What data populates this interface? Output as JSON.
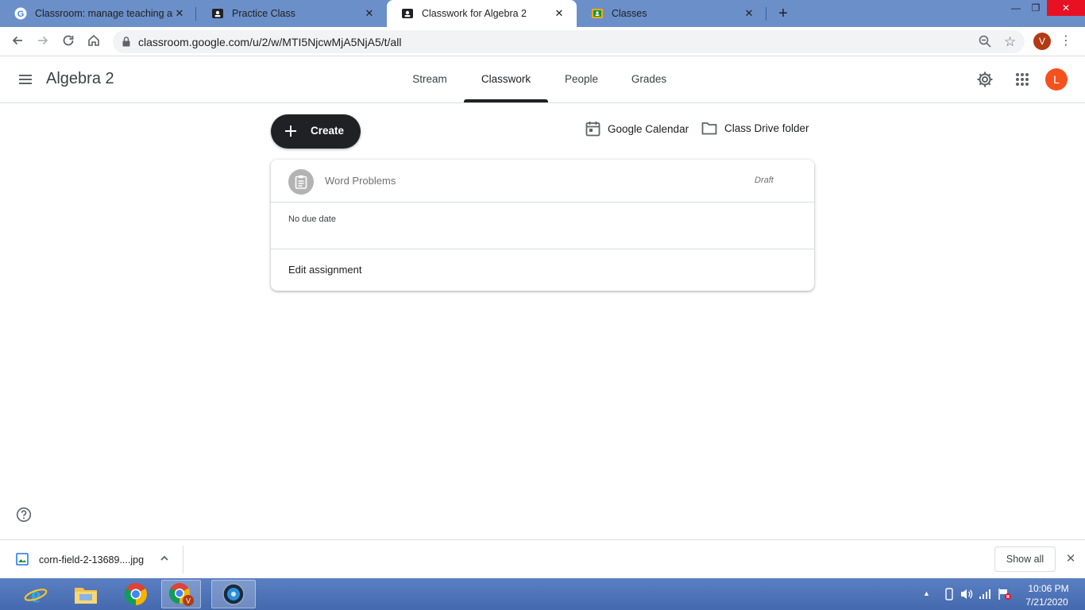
{
  "browser": {
    "tabs": [
      {
        "title": "Classroom: manage teaching and",
        "active": false
      },
      {
        "title": "Practice Class",
        "active": false
      },
      {
        "title": "Classwork for Algebra 2",
        "active": true
      },
      {
        "title": "Classes",
        "active": false
      }
    ],
    "close_glyph": "✕",
    "new_tab_glyph": "+",
    "url": "classroom.google.com/u/2/w/MTI5NjcwMjA5NjA5/t/all",
    "profile_initial": "V",
    "window_controls": {
      "minimize": "—",
      "restore": "❐",
      "close": "✕"
    }
  },
  "classroom": {
    "class_name": "Algebra 2",
    "nav_tabs": [
      "Stream",
      "Classwork",
      "People",
      "Grades"
    ],
    "selected_tab": "Classwork",
    "user_initial": "L",
    "avatar_color": "#f4511e"
  },
  "classwork": {
    "create_label": "Create",
    "calendar_link": "Google Calendar",
    "drive_link": "Class Drive folder",
    "assignment": {
      "title": "Word Problems",
      "status": "Draft",
      "due": "No due date",
      "action": "Edit assignment"
    }
  },
  "downloads": {
    "file_name": "corn-field-2-13689....jpg",
    "show_all_label": "Show all"
  },
  "taskbar": {
    "time": "10:06 PM",
    "date": "7/21/2020"
  },
  "colors": {
    "tabstrip": "#6b8fc9",
    "create_button": "#202124",
    "profile_v": "#b23a14"
  }
}
